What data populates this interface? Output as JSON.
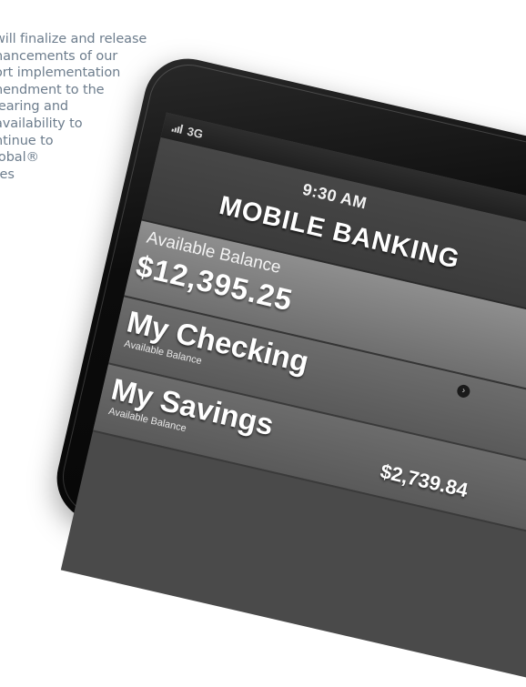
{
  "copy": {
    "lines": [
      "will finalize and release",
      "hancements of our",
      "ort implementation",
      "nendment to the",
      "learing and",
      "availability to",
      "ntinue to",
      "lobal®",
      "res"
    ]
  },
  "phone": {
    "status": {
      "network": "3G",
      "icon": "signal-bars-icon"
    },
    "time": "9:30 AM",
    "title": "MOBILE BANKING",
    "balance": {
      "label": "Available Balance",
      "amount": "$12,395.25"
    },
    "accounts": [
      {
        "name": "My Checking",
        "sub": "Available Balance",
        "amount": "",
        "icon": "chevron-right-icon"
      },
      {
        "name": "My Savings",
        "sub": "Available Balance",
        "amount": "$2,739.84"
      }
    ]
  }
}
